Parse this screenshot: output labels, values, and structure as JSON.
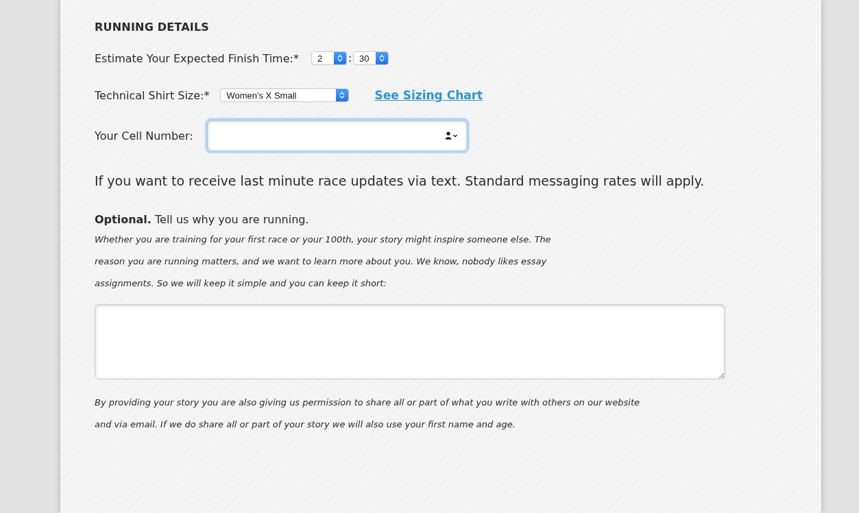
{
  "section_title": "RUNNING DETAILS",
  "finish_time": {
    "label": "Estimate Your Expected Finish Time:*",
    "hours": "2",
    "separator": ":",
    "minutes": "30"
  },
  "shirt_size": {
    "label": "Technical Shirt Size:*",
    "value": "Women's X Small",
    "link": "See Sizing Chart"
  },
  "cell_number": {
    "label": "Your Cell Number:",
    "focused": true
  },
  "cell_note": "If you want to receive last minute race updates via text. Standard messaging rates will apply.",
  "optional_prompt": "**Optional.** Tell us why you are running.",
  "story_intro": "Whether you are training for your first race or your 100th, your story might inspire someone else. The reason you are running matters, and we want to learn more about you. We know, nobody likes essay assignments. So we will keep it simple and you can keep it short:",
  "story_consent": "By providing your story you are also giving us permission to share all or part of what you write with others on our website and via email. If we do share all or part of your story we will also use your first name and age."
}
